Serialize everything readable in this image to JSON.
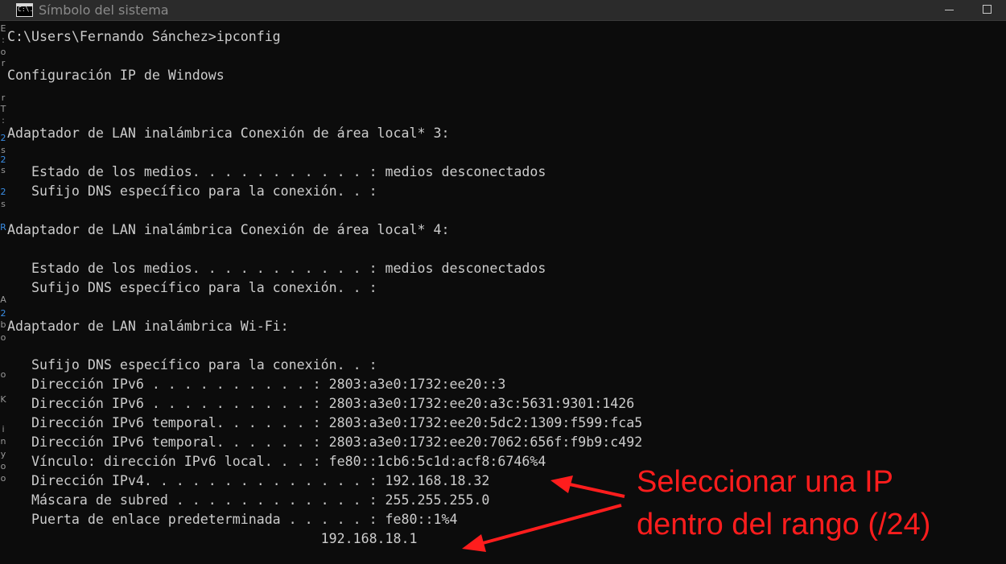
{
  "window": {
    "title": "Símbolo del sistema",
    "icon": "cmd-icon",
    "icon_text": "C:\\."
  },
  "left_strip": [
    "E",
    ":",
    "o",
    "r",
    "r",
    "T",
    ":",
    "2",
    "s",
    "2",
    "s",
    "2",
    "s",
    "R",
    "A",
    "2",
    "b",
    "o",
    "o",
    "K",
    "i",
    "n",
    "y",
    "o",
    "o"
  ],
  "console": {
    "lines": [
      "C:\\Users\\Fernando Sánchez>ipconfig",
      "",
      "Configuración IP de Windows",
      "",
      "",
      "Adaptador de LAN inalámbrica Conexión de área local* 3:",
      "",
      "   Estado de los medios. . . . . . . . . . . : medios desconectados",
      "   Sufijo DNS específico para la conexión. . :",
      "",
      "Adaptador de LAN inalámbrica Conexión de área local* 4:",
      "",
      "   Estado de los medios. . . . . . . . . . . : medios desconectados",
      "   Sufijo DNS específico para la conexión. . :",
      "",
      "Adaptador de LAN inalámbrica Wi-Fi:",
      "",
      "   Sufijo DNS específico para la conexión. . :",
      "   Dirección IPv6 . . . . . . . . . . : 2803:a3e0:1732:ee20::3",
      "   Dirección IPv6 . . . . . . . . . . : 2803:a3e0:1732:ee20:a3c:5631:9301:1426",
      "   Dirección IPv6 temporal. . . . . . : 2803:a3e0:1732:ee20:5dc2:1309:f599:fca5",
      "   Dirección IPv6 temporal. . . . . . : 2803:a3e0:1732:ee20:7062:656f:f9b9:c492",
      "   Vínculo: dirección IPv6 local. . . : fe80::1cb6:5c1d:acf8:6746%4",
      "   Dirección IPv4. . . . . . . . . . . . . . : 192.168.18.32",
      "   Máscara de subred . . . . . . . . . . . . : 255.255.255.0",
      "   Puerta de enlace predeterminada . . . . . : fe80::1%4",
      "                                       192.168.18.1"
    ]
  },
  "annotation": {
    "line1": "Seleccionar una IP",
    "line2": "dentro del rango (/24)",
    "color": "#ff1d1d"
  },
  "colors": {
    "background": "#0c0c0c",
    "text": "#cccccc",
    "titlebar": "#2b2b2b"
  }
}
